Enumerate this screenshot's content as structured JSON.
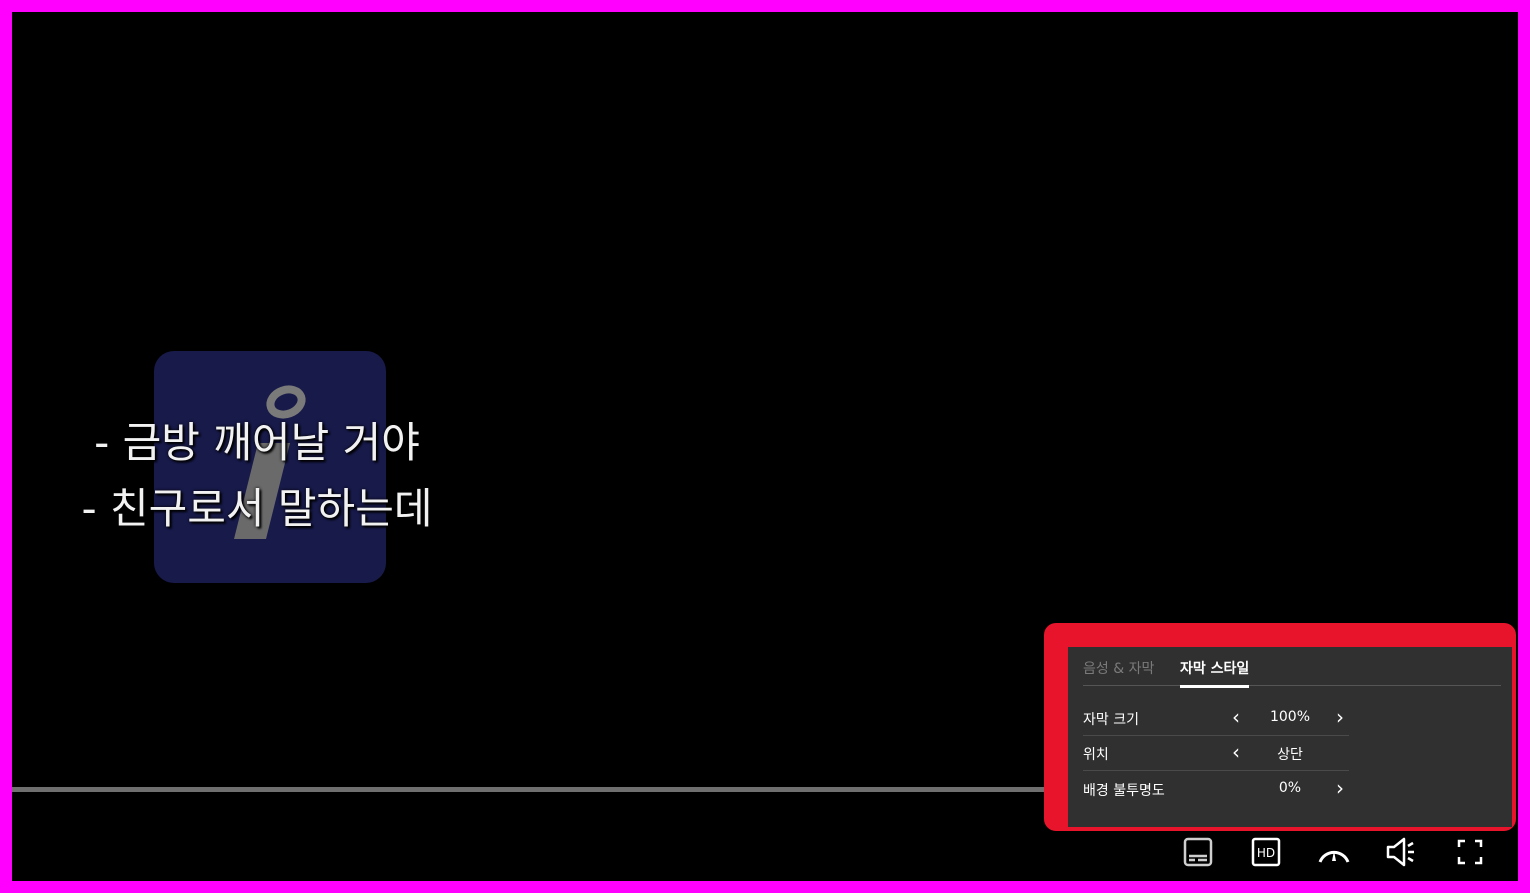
{
  "subtitles": {
    "line1": "- 금방 깨어날 거야",
    "line2": "- 친구로서 말하는데"
  },
  "settings_panel": {
    "tabs": [
      {
        "label": "음성 & 자막",
        "active": false
      },
      {
        "label": "자막 스타일",
        "active": true
      }
    ],
    "rows": [
      {
        "label": "자막 크기",
        "value": "100%",
        "has_prev": true,
        "has_next": true
      },
      {
        "label": "위치",
        "value": "상단",
        "has_prev": true,
        "has_next": false
      },
      {
        "label": "배경 불투명도",
        "value": "0%",
        "has_prev": false,
        "has_next": true
      }
    ],
    "prev_arrow": "‹",
    "next_arrow": "›"
  },
  "controls": {
    "subtitles_icon": "subtitles-icon",
    "hd_icon": "hd-icon",
    "hd_label": "HD",
    "speed_icon": "playback-speed-icon",
    "volume_icon": "volume-icon",
    "fullscreen_icon": "fullscreen-icon"
  },
  "colors": {
    "frame": "#ff00ff",
    "highlight": "#e8142c",
    "panel_bg": "#303030",
    "badge_bg": "#181a4a"
  }
}
